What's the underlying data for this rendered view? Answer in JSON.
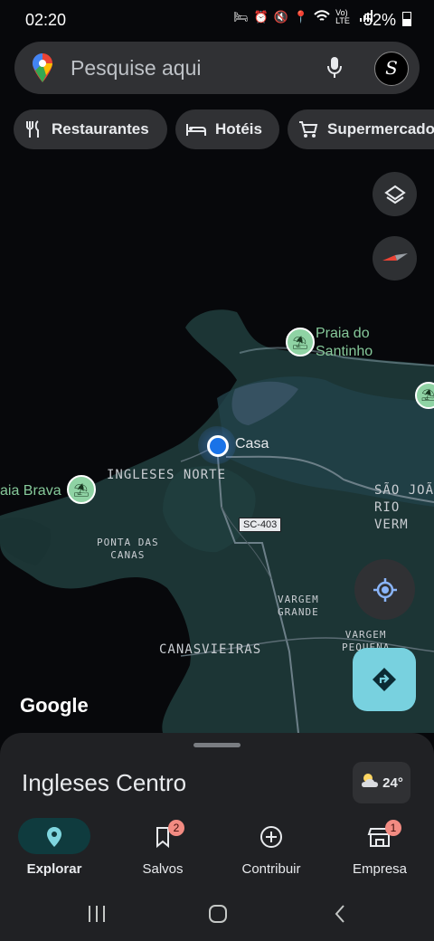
{
  "status_bar": {
    "time": "02:20",
    "network": "Vo) LTE",
    "battery": "52%"
  },
  "search": {
    "placeholder": "Pesquise aqui",
    "avatar_text": "S"
  },
  "chips": [
    {
      "label": "Restaurantes",
      "icon": "fork-knife-icon"
    },
    {
      "label": "Hotéis",
      "icon": "bed-icon"
    },
    {
      "label": "Supermercado",
      "icon": "cart-icon"
    }
  ],
  "map": {
    "poi": {
      "praia_santinho": [
        "Praia do",
        "Santinho"
      ],
      "praia_brava": "aia Brava"
    },
    "my_location_label": "Casa",
    "areas": {
      "ingleses_norte": "INGLESES NORTE",
      "sao_joao": [
        "SÃO JOÃ",
        "RIO VERM"
      ],
      "ponta_das_canas": [
        "PONTA DAS",
        "CANAS"
      ],
      "vargem_grande": [
        "VARGEM",
        "GRANDE"
      ],
      "canasvieiras": "CANASVIEIRAS",
      "vargem_pequena": [
        "VARGEM",
        "PEQUENA"
      ]
    },
    "road_shield": "SC-403",
    "brand": "Google"
  },
  "sheet": {
    "title": "Ingleses Centro",
    "weather_temp": "24°"
  },
  "bottom_nav": [
    {
      "label": "Explorar",
      "icon": "location-pin-icon",
      "active": true
    },
    {
      "label": "Salvos",
      "icon": "bookmark-icon",
      "badge": "2"
    },
    {
      "label": "Contribuir",
      "icon": "add-circle-icon"
    },
    {
      "label": "Empresa",
      "icon": "store-icon",
      "badge": "1"
    }
  ],
  "colors": {
    "map_land": "#1c3a3a",
    "map_water": "#07080b",
    "accent": "#8ab4f8",
    "directions_fab": "#78d1df"
  }
}
